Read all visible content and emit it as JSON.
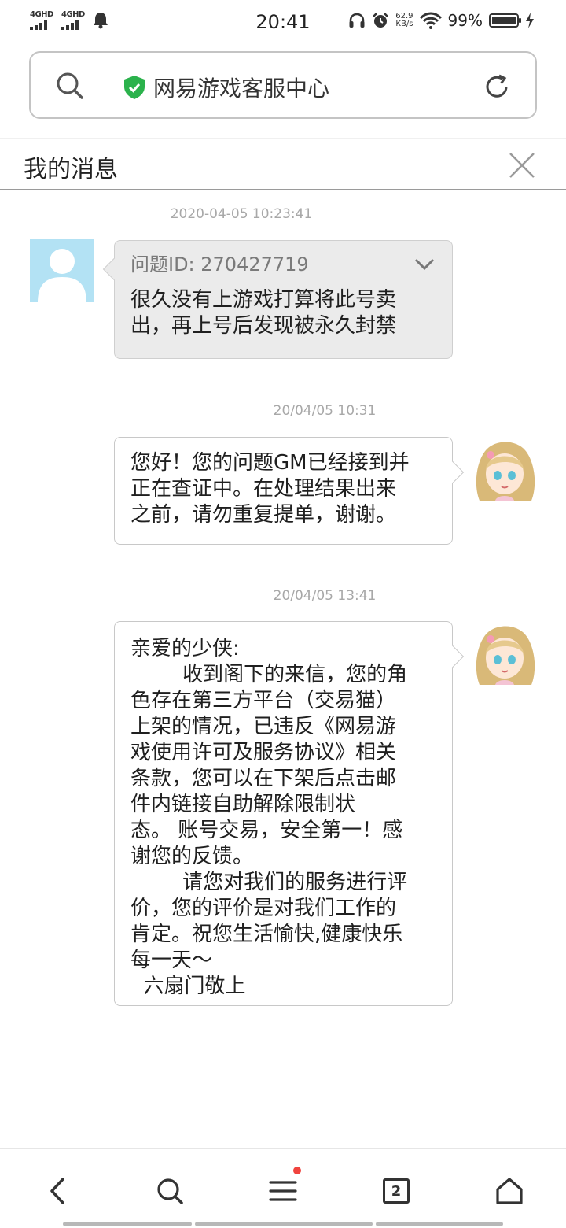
{
  "status_bar": {
    "net1": "4GHD",
    "net2": "4GHD",
    "time": "20:41",
    "speed_value": "62.9",
    "speed_unit": "KB/s",
    "battery": "99%",
    "battery_level": 0.99
  },
  "address_bar": {
    "site_name": "网易游戏客服中心",
    "secure_color": "#2bb24c"
  },
  "header": {
    "title": "我的消息"
  },
  "messages": [
    {
      "timestamp": "2020-04-05 10:23:41",
      "sender": "user",
      "question_id": "问题ID: 270427719",
      "lines": [
        "很久没有上游戏打算将此号卖",
        "出，再上号后发现被永久封禁"
      ]
    },
    {
      "timestamp": "20/04/05 10:31",
      "sender": "gm",
      "lines": [
        "您好！您的问题GM已经接到并",
        "正在查证中。在处理结果出来",
        "之前，请勿重复提单，谢谢。"
      ]
    },
    {
      "timestamp": "20/04/05 13:41",
      "sender": "gm",
      "lines": [
        "亲爱的少侠:",
        "        收到阁下的来信，您的角",
        "色存在第三方平台（交易猫）",
        "上架的情况，已违反《网易游",
        "戏使用许可及服务协议》相关",
        "条款，您可以在下架后点击邮",
        "件内链接自助解除限制状",
        "态。 账号交易，安全第一！感",
        "谢您的反馈。",
        "        请您对我们的服务进行评",
        "价，您的评价是对我们工作的",
        "肯定。祝您生活愉快,健康快乐",
        "每一天～",
        "  六扇门敬上"
      ]
    }
  ],
  "bottom_nav": {
    "tab_count": "2",
    "notification_color": "#f0433e"
  }
}
